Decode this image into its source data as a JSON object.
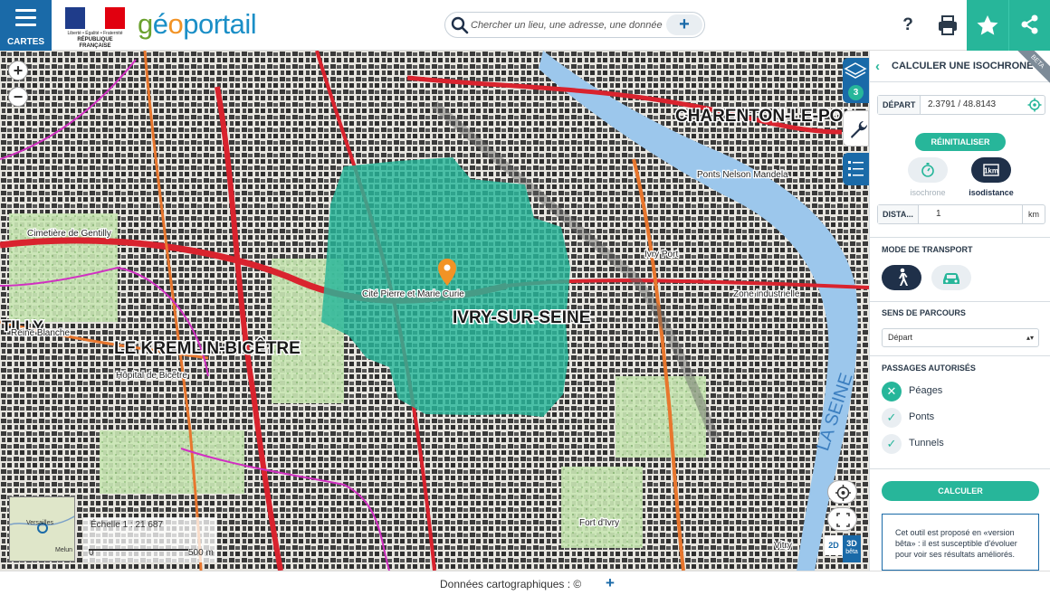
{
  "header": {
    "menu_label": "CARTES",
    "rf_motto": "Liberté • Égalité • Fraternité",
    "rf_name": "RÉPUBLIQUE FRANÇAISE",
    "brand_g": "g",
    "brand_e": "é",
    "brand_o": "o",
    "brand_rest": "portail",
    "search_placeholder": "Chercher un lieu, une adresse, une donnée",
    "search_plus": "+",
    "help_label": "?"
  },
  "map": {
    "zoom_in": "+",
    "zoom_out": "−",
    "layers_count": "3",
    "places": {
      "charenton": "CHARENTON-LE-PONT",
      "kremlin": "LE KREMLIN-BICÊTRE",
      "ivry": "IVRY-SUR-SEINE",
      "tilly": "TILLY",
      "ivry_port": "Ivry Port",
      "cite": "Cité Pierre et Marie Curie",
      "reine": "Reine Blanche",
      "vitry": "Vitry",
      "fort": "Fort d'Ivry",
      "la_seine": "LA SEINE",
      "gentilly": "Cimetière de Gentilly",
      "hopital": "Hôpital de Bicêtre",
      "zone": "Zone industrielle",
      "mandela": "Ponts Nelson Mandela"
    },
    "minimap_labels": [
      "Versailles",
      "Melun"
    ],
    "scale_text": "Échelle 1 : 21 687",
    "scale_zero": "0",
    "scale_end": "500 m",
    "btn_2d": "2D",
    "btn_3d": "3D",
    "btn_beta": "bêta",
    "marker_color": "#f29325",
    "isochrone_color": "#27b69a"
  },
  "footer": {
    "data_text": "Données cartographiques : ©",
    "plus": "+"
  },
  "panel": {
    "title": "CALCULER UNE ISOCHRONE",
    "beta": "BETA",
    "depart_label": "DÉPART",
    "depart_value": "2.3791 / 48.8143",
    "reset_label": "RÉINITIALISER",
    "isochrone_label": "isochrone",
    "isodistance_label": "isodistance",
    "distance_label": "DISTA...",
    "distance_value": "1",
    "distance_unit": "km",
    "transport_title": "MODE DE TRANSPORT",
    "sens_title": "SENS DE PARCOURS",
    "sens_value": "Départ",
    "sens_arrow": "▴▾",
    "passages_title": "PASSAGES AUTORISÉS",
    "passages": [
      {
        "label": "Péages",
        "mark": "✕"
      },
      {
        "label": "Ponts",
        "mark": "✓"
      },
      {
        "label": "Tunnels",
        "mark": "✓"
      }
    ],
    "calc_label": "CALCULER",
    "note": "Cet outil est proposé en «version bêta» : il est susceptible d'évoluer pour voir ses résultats améliorés."
  },
  "colors": {
    "primary_blue": "#1a6aa8",
    "accent_green": "#27b69a",
    "dark_navy": "#1f3049"
  }
}
